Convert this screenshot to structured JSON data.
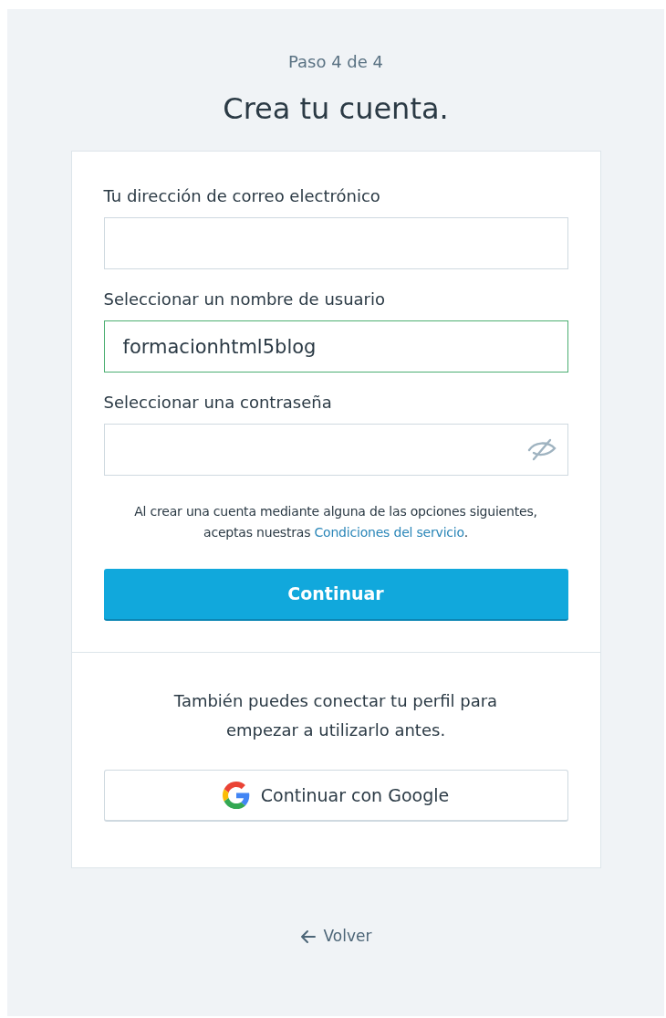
{
  "step": "Paso 4 de 4",
  "title": "Crea tu cuenta.",
  "fields": [
    {
      "kind": "text",
      "label": "Tu dirección de correo electrónico",
      "focused": false
    },
    {
      "kind": "text",
      "label": "Seleccionar un nombre de usuario",
      "value": "formacionhtml5blog",
      "focused": true
    },
    {
      "kind": "password",
      "label": "Seleccionar una contraseña",
      "focused": false
    }
  ],
  "terms": {
    "before": "Al crear una cuenta mediante alguna de las opciones siguientes, aceptas nuestras ",
    "link": "Condiciones del servicio",
    "after": "."
  },
  "primary_button": "Continuar",
  "social_prompt": "También puedes conectar tu perfil para empezar a utilizarlo antes.",
  "google_button": "Continuar con Google",
  "back_link": "Volver"
}
